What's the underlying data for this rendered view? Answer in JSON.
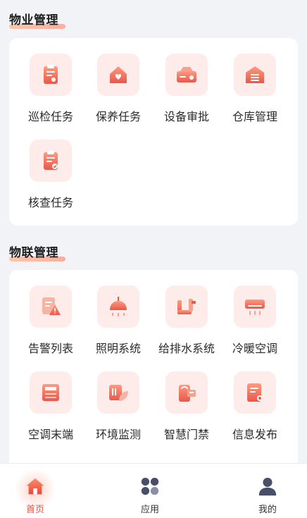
{
  "sections": {
    "property": {
      "title": "物业管理",
      "items": [
        {
          "label": "巡检任务",
          "icon": "clipboard-person-icon"
        },
        {
          "label": "保养任务",
          "icon": "house-heart-icon"
        },
        {
          "label": "设备审批",
          "icon": "device-approval-icon"
        },
        {
          "label": "仓库管理",
          "icon": "warehouse-icon"
        },
        {
          "label": "核查任务",
          "icon": "clipboard-check-icon"
        }
      ]
    },
    "iot": {
      "title": "物联管理",
      "items": [
        {
          "label": "告警列表",
          "icon": "alert-list-icon"
        },
        {
          "label": "照明系统",
          "icon": "lamp-icon"
        },
        {
          "label": "给排水系统",
          "icon": "pipe-faucet-icon"
        },
        {
          "label": "冷暖空调",
          "icon": "air-conditioner-icon"
        },
        {
          "label": "空调末端",
          "icon": "ac-terminal-icon"
        },
        {
          "label": "环境监测",
          "icon": "environment-leaf-icon"
        },
        {
          "label": "智慧门禁",
          "icon": "door-access-icon"
        },
        {
          "label": "信息发布",
          "icon": "info-publish-icon"
        }
      ]
    }
  },
  "tabbar": {
    "tabs": [
      {
        "label": "首页",
        "icon": "home-icon",
        "active": true
      },
      {
        "label": "应用",
        "icon": "apps-grid-icon",
        "active": false
      },
      {
        "label": "我的",
        "icon": "user-icon",
        "active": false
      }
    ]
  },
  "colors": {
    "accent": "#e8584a",
    "icon_bg": "#fdecea",
    "page_bg": "#f2f3f7",
    "tab_inactive": "#4a4f68"
  }
}
